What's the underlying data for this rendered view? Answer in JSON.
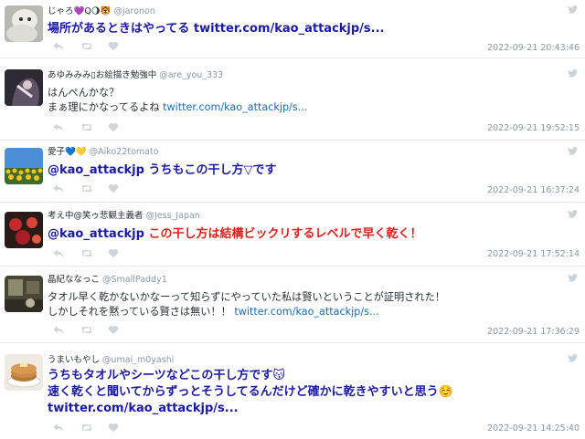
{
  "tweets": [
    {
      "name": "じゃろ💜Q🌖🐯",
      "handle": "@jaronon",
      "line1": "場所があるときはやってる ",
      "link": "twitter.com/kao_attackjp/s...",
      "timestamp": "2022-09-21 20:43:46"
    },
    {
      "name": "あゆみみみ▯お絵描き勉強中",
      "handle": "@are_you_333",
      "line1": "はんぺんかな？",
      "line2": "まぁ理にかなってるよね ",
      "link": "twitter.com/kao_attackjp/s...",
      "timestamp": "2022-09-21 19:52:15"
    },
    {
      "name": "愛子💙💛",
      "handle": "@Aiko22tomato",
      "mention": "@kao_attackjp",
      "line1": " うちもこの干し方▽です",
      "timestamp": "2022-09-21 16:37:24"
    },
    {
      "name": "考え中@笑ゥ悲観主義者",
      "handle": "@Jess_Japan",
      "mention": "@kao_attackjp",
      "line1": " この干し方は結構ビックリするレベルで早く乾く！",
      "timestamp": "2022-09-21 17:52:14"
    },
    {
      "name": "晶紀ななっこ",
      "handle": "@SmallPaddy1",
      "line1": "タオル早く乾かないかなーって知らずにやっていた私は賢いということが証明された！",
      "line2": "しかしそれを黙っている賢さは無い！！ ",
      "link": "twitter.com/kao_attackjp/s...",
      "timestamp": "2022-09-21 17:36:29"
    },
    {
      "name": "うまいもやし",
      "handle": "@umai_m0yashi",
      "line1": "うちもタオルやシーツなどこの干し方です😽",
      "line2": "速く乾くと聞いてからずっとそうしてるんだけど確かに乾きやすいと思う☺️",
      "link": "twitter.com/kao_attackjp/s...",
      "timestamp": "2022-09-21 14:25:40"
    }
  ],
  "icons": {
    "reply": "reply-icon",
    "retweet": "retweet-icon",
    "like": "heart-icon",
    "brand": "twitter-bird-icon"
  },
  "colors": {
    "bold_text": "#1a1aa8",
    "red_text": "#e0201a",
    "link": "#1b6bb5",
    "muted": "#8899a6",
    "icon": "#cdd5dc"
  }
}
